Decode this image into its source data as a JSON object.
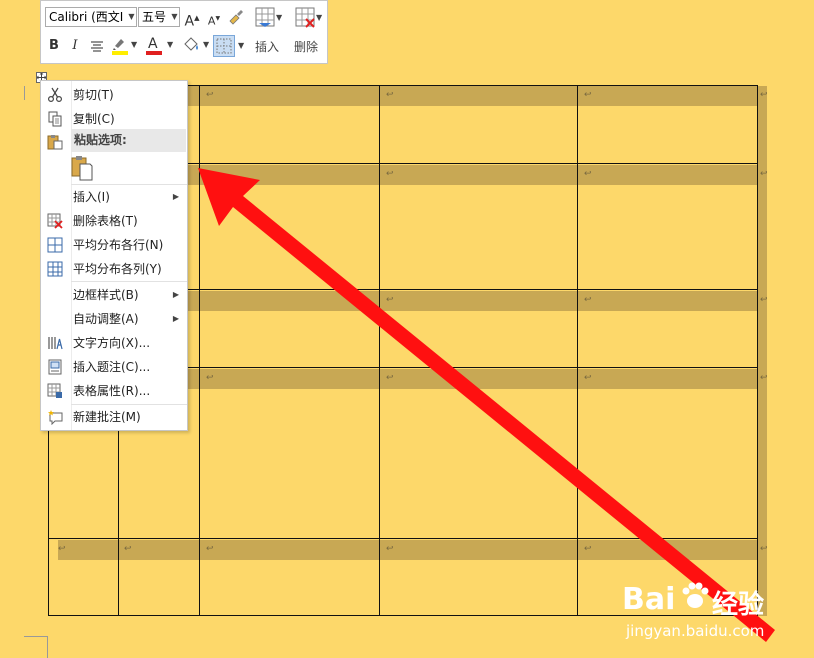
{
  "mini_toolbar": {
    "font_family": "Calibri (西文Ⅰ",
    "font_size": "五号",
    "grow_font": "A",
    "shrink_font": "A",
    "bold": "B",
    "italic": "I",
    "font_color_letter": "A",
    "insert_label": "插入",
    "delete_label": "删除"
  },
  "context_menu": {
    "items": [
      {
        "label": "剪切(T)",
        "icon": "scissors-icon"
      },
      {
        "label": "复制(C)",
        "icon": "copy-icon"
      },
      {
        "label": "粘贴选项:",
        "icon": "paste-icon"
      },
      {
        "label": "插入(I)",
        "icon": "",
        "submenu": true
      },
      {
        "label": "删除表格(T)",
        "icon": "delete-table-icon"
      },
      {
        "label": "平均分布各行(N)",
        "icon": "distribute-rows-icon"
      },
      {
        "label": "平均分布各列(Y)",
        "icon": "distribute-columns-icon"
      },
      {
        "label": "边框样式(B)",
        "icon": "",
        "submenu": true
      },
      {
        "label": "自动调整(A)",
        "icon": "",
        "submenu": true
      },
      {
        "label": "文字方向(X)...",
        "icon": "text-direction-icon"
      },
      {
        "label": "插入题注(C)...",
        "icon": "insert-caption-icon"
      },
      {
        "label": "表格属性(R)...",
        "icon": "table-properties-icon"
      },
      {
        "label": "新建批注(M)",
        "icon": "new-comment-icon"
      }
    ]
  },
  "table": {
    "cell_mark": "↩"
  },
  "watermark": {
    "brand": "Bai",
    "brand2": "经验",
    "url": "jingyan.baidu.com"
  },
  "colors": {
    "page_background": "#fdd86a",
    "row_band": "#c8a854",
    "arrow": "#ff1010",
    "font_color_bar": "#e02020",
    "highlight_bar": "#ffee00"
  }
}
